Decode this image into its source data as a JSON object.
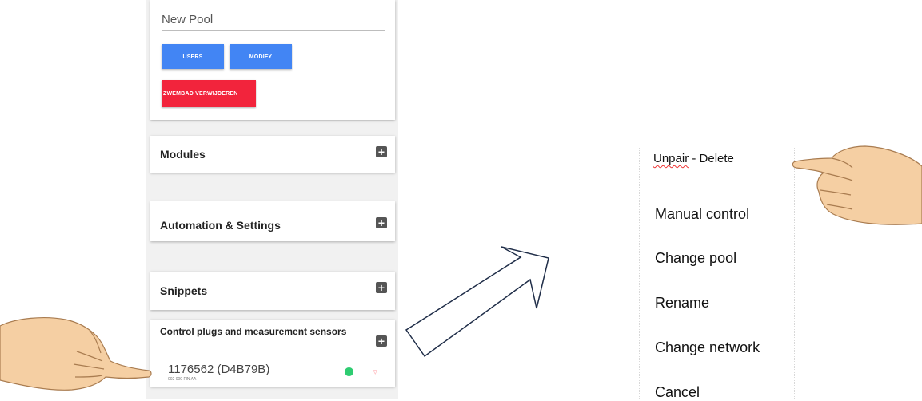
{
  "pool": {
    "name": "New Pool",
    "users_button": "USERS",
    "modify_button": "MODIFY",
    "delete_button": "ZWEMBAD VERWIJDEREN"
  },
  "sections": {
    "modules": "Modules",
    "automation": "Automation & Settings",
    "snippets": "Snippets",
    "control_plugs": "Control plugs and measurement sensors"
  },
  "device": {
    "name": "1176562 (D4B79B)",
    "subtext": "002 000 FIN AA",
    "status_color": "#2ecc71"
  },
  "context_menu": {
    "unpair_word": "Unpair",
    "unpair_rest": " - Delete",
    "items": [
      "Manual control",
      "Change pool",
      "Rename",
      "Change network",
      "Cancel"
    ]
  },
  "icons": [
    "plus-icon",
    "wifi-icon",
    "status-dot-icon",
    "pointing-hand-icon",
    "arrow-icon"
  ],
  "colors": {
    "primary": "#4285f4",
    "danger": "#f2243c",
    "status_ok": "#2ecc71"
  }
}
